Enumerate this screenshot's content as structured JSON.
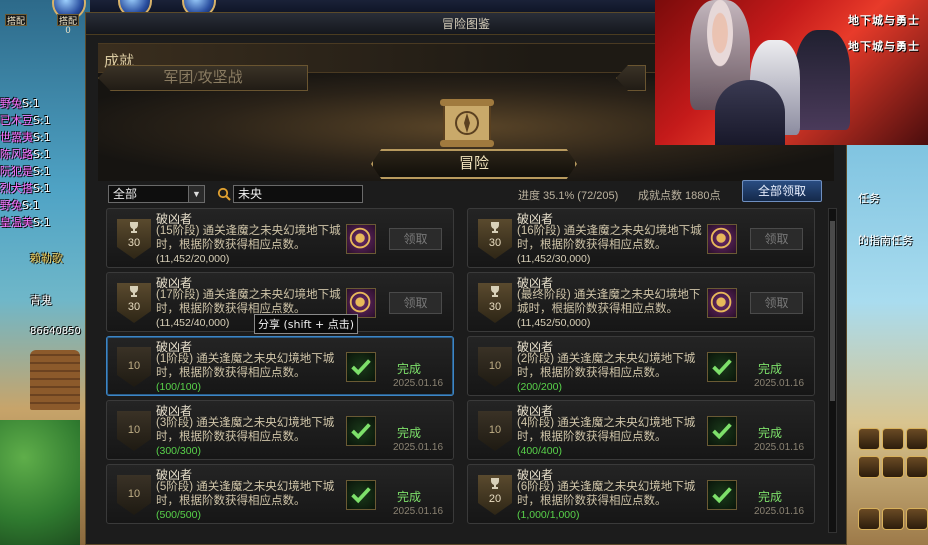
{
  "window": {
    "title": "冒险图鉴"
  },
  "section_header": "成就",
  "tabs": {
    "left": "军团/攻坚战",
    "main": "冒险"
  },
  "filter": {
    "selected": "全部"
  },
  "search": {
    "value": "未央"
  },
  "progress": {
    "text": "进度  35.1% (72/205)"
  },
  "points": {
    "text": "成就点数 1880点"
  },
  "claim_all_label": "全部领取",
  "tooltip": "分享 (shift + 点击)",
  "hud": {
    "badge_left": "搭配",
    "badge_left_count": "0",
    "badge_right": "搭配",
    "badge_right_count": "0"
  },
  "party": [
    {
      "name": "野兔",
      "val": "S:1"
    },
    {
      "name": "已木豆",
      "val": "S:1"
    },
    {
      "name": "世嚣夷",
      "val": "S:1"
    },
    {
      "name": "陈风路",
      "val": "S:1"
    },
    {
      "name": "阮犯是",
      "val": "S:1"
    },
    {
      "name": "烈犬搭",
      "val": "S:1"
    },
    {
      "name": "野兔",
      "val": "S:1"
    },
    {
      "name": "皇温美",
      "val": "S:1"
    }
  ],
  "party_extra": [
    "赖勒歌",
    "青鬼",
    "86640850"
  ],
  "right_texts": [
    "任务",
    "的指南任务"
  ],
  "achievements": [
    {
      "title": "破凶者",
      "desc": "(15阶段) 通关逢魔之未央幻境地下城时，根据阶数获得相应点数。",
      "progress": "(11,452/20,000)",
      "badge": "30",
      "state": "claim",
      "claim_label": "领取"
    },
    {
      "title": "破凶者",
      "desc": "(16阶段) 通关逢魔之未央幻境地下城时，根据阶数获得相应点数。",
      "progress": "(11,452/30,000)",
      "badge": "30",
      "state": "claim",
      "claim_label": "领取"
    },
    {
      "title": "破凶者",
      "desc": "(17阶段) 通关逢魔之未央幻境地下城时，根据阶数获得相应点数。",
      "progress": "(11,452/40,000)",
      "badge": "30",
      "state": "claim",
      "claim_label": "领取"
    },
    {
      "title": "破凶者",
      "desc": "(最终阶段) 通关逢魔之未央幻境地下城时，根据阶数获得相应点数。",
      "progress": "(11,452/50,000)",
      "badge": "30",
      "state": "claim",
      "claim_label": "领取"
    },
    {
      "title": "破凶者",
      "desc": "(1阶段) 通关逢魔之未央幻境地下城时，根据阶数获得相应点数。",
      "progress": "(100/100)",
      "badge": "10",
      "state": "done",
      "status": "完成",
      "date": "2025.01.16"
    },
    {
      "title": "破凶者",
      "desc": "(2阶段) 通关逢魔之未央幻境地下城时，根据阶数获得相应点数。",
      "progress": "(200/200)",
      "badge": "10",
      "state": "done",
      "status": "完成",
      "date": "2025.01.16"
    },
    {
      "title": "破凶者",
      "desc": "(3阶段) 通关逢魔之未央幻境地下城时，根据阶数获得相应点数。",
      "progress": "(300/300)",
      "badge": "10",
      "state": "done",
      "status": "完成",
      "date": "2025.01.16"
    },
    {
      "title": "破凶者",
      "desc": "(4阶段) 通关逢魔之未央幻境地下城时，根据阶数获得相应点数。",
      "progress": "(400/400)",
      "badge": "10",
      "state": "done",
      "status": "完成",
      "date": "2025.01.16"
    },
    {
      "title": "破凶者",
      "desc": "(5阶段) 通关逢魔之未央幻境地下城时，根据阶数获得相应点数。",
      "progress": "(500/500)",
      "badge": "10",
      "state": "done",
      "status": "完成",
      "date": "2025.01.16"
    },
    {
      "title": "破凶者",
      "desc": "(6阶段) 通关逢魔之未央幻境地下城时，根据阶数获得相应点数。",
      "progress": "(1,000/1,000)",
      "badge": "20",
      "state": "done",
      "status": "完成",
      "date": "2025.01.16"
    }
  ],
  "icons": {
    "search": "search-icon",
    "scroll": "scroll-compass-icon",
    "reward_claim": "emblem-reward-icon",
    "reward_done": "checkmark-icon",
    "trophy": "trophy-icon"
  },
  "colors": {
    "complete_green": "#58d24a",
    "accent_blue": "#3d86c6",
    "gold_border": "#b89a5e"
  }
}
